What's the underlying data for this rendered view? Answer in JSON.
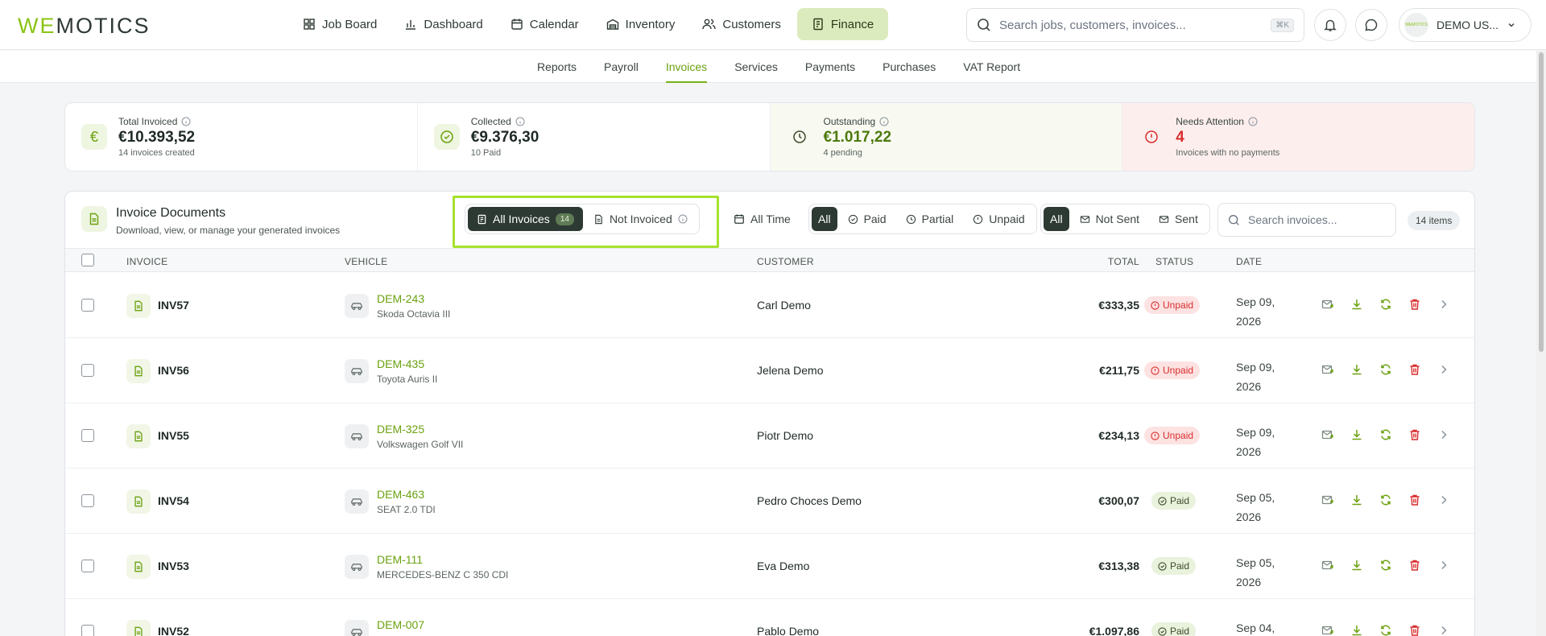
{
  "brand": {
    "logo_a": "WE",
    "logo_b": "MOTICS"
  },
  "nav": [
    {
      "label": "Job Board",
      "icon": "grid-icon"
    },
    {
      "label": "Dashboard",
      "icon": "bar-chart-icon"
    },
    {
      "label": "Calendar",
      "icon": "calendar-icon"
    },
    {
      "label": "Inventory",
      "icon": "warehouse-icon"
    },
    {
      "label": "Customers",
      "icon": "users-icon"
    },
    {
      "label": "Finance",
      "icon": "receipt-icon",
      "active": true
    }
  ],
  "search": {
    "placeholder": "Search jobs, customers, invoices...",
    "shortcut": "⌘K"
  },
  "user": {
    "name": "DEMO US...",
    "avatar_text": "WEMOTICS"
  },
  "subnav": [
    "Reports",
    "Payroll",
    "Invoices",
    "Services",
    "Payments",
    "Purchases",
    "VAT Report"
  ],
  "subnav_active": "Invoices",
  "stats": [
    {
      "label": "Total Invoiced",
      "value": "€10.393,52",
      "sub": "14 invoices created",
      "icon": "euro-icon"
    },
    {
      "label": "Collected",
      "value": "€9.376,30",
      "sub": "10 Paid",
      "icon": "check-circle-icon"
    },
    {
      "label": "Outstanding",
      "value": "€1.017,22",
      "sub": "4 pending",
      "icon": "clock-icon"
    },
    {
      "label": "Needs Attention",
      "value": "4",
      "sub": "Invoices with no payments",
      "icon": "alert-circle-icon"
    }
  ],
  "panel": {
    "title": "Invoice Documents",
    "subtitle": "Download, view, or manage your generated invoices",
    "filter_invoices": {
      "all_label": "All Invoices",
      "all_count": "14",
      "not_label": "Not Invoiced"
    },
    "time_label": "All Time",
    "status_filter": [
      "All",
      "Paid",
      "Partial",
      "Unpaid"
    ],
    "sent_filter": [
      "All",
      "Not Sent",
      "Sent"
    ],
    "search_placeholder": "Search invoices...",
    "items_count": "14 items"
  },
  "columns": {
    "invoice": "INVOICE",
    "vehicle": "VEHICLE",
    "customer": "CUSTOMER",
    "total": "TOTAL",
    "status": "STATUS",
    "date": "DATE"
  },
  "rows": [
    {
      "invoice": "INV57",
      "plate": "DEM-243",
      "model": "Skoda Octavia III",
      "customer": "Carl Demo",
      "total": "€333,35",
      "status": "Unpaid",
      "date1": "Sep 09,",
      "date2": "2026"
    },
    {
      "invoice": "INV56",
      "plate": "DEM-435",
      "model": "Toyota Auris II",
      "customer": "Jelena Demo",
      "total": "€211,75",
      "status": "Unpaid",
      "date1": "Sep 09,",
      "date2": "2026"
    },
    {
      "invoice": "INV55",
      "plate": "DEM-325",
      "model": "Volkswagen Golf VII",
      "customer": "Piotr Demo",
      "total": "€234,13",
      "status": "Unpaid",
      "date1": "Sep 09,",
      "date2": "2026"
    },
    {
      "invoice": "INV54",
      "plate": "DEM-463",
      "model": "SEAT 2.0 TDI",
      "customer": "Pedro Choces Demo",
      "total": "€300,07",
      "status": "Paid",
      "date1": "Sep 05,",
      "date2": "2026"
    },
    {
      "invoice": "INV53",
      "plate": "DEM-111",
      "model": "MERCEDES-BENZ C 350 CDI",
      "customer": "Eva Demo",
      "total": "€313,38",
      "status": "Paid",
      "date1": "Sep 05,",
      "date2": "2026"
    },
    {
      "invoice": "INV52",
      "plate": "DEM-007",
      "model": "",
      "customer": "Pablo Demo",
      "total": "€1.097,86",
      "status": "Paid",
      "date1": "Sep 04,",
      "date2": ""
    }
  ],
  "colors": {
    "accent": "#78b418",
    "dark": "#2d3a33",
    "danger": "#d92d2d",
    "highlight": "#a6e22e"
  }
}
